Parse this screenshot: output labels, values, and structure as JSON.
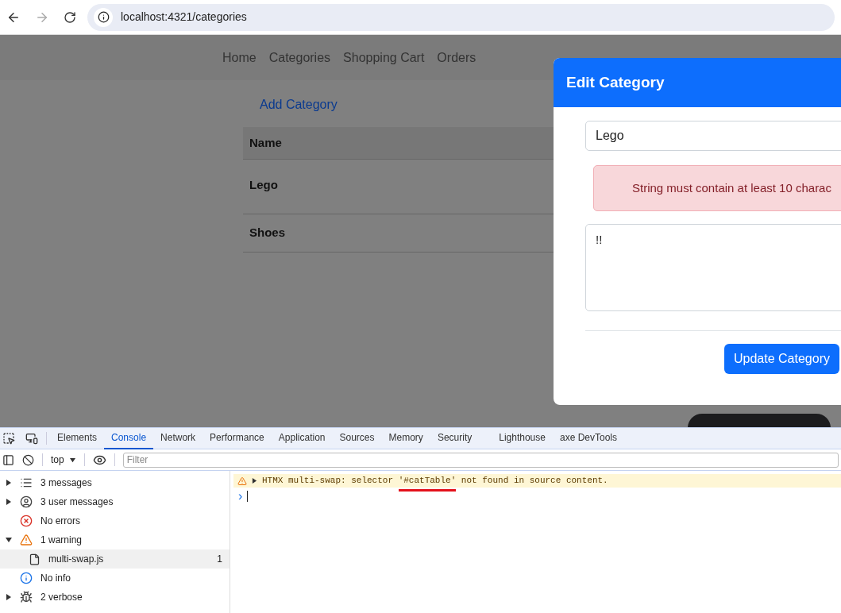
{
  "browser": {
    "back_disabled": false,
    "forward_disabled": true,
    "url": "localhost:4321/categories"
  },
  "nav": {
    "links": [
      "Home",
      "Categories",
      "Shopping Cart",
      "Orders"
    ]
  },
  "page": {
    "add_link": "Add Category",
    "table": {
      "columns": [
        "Name"
      ],
      "rows": [
        [
          "Lego"
        ],
        [
          "Shoes"
        ]
      ]
    }
  },
  "modal": {
    "title": "Edit Category",
    "name_value": "Lego",
    "alert": "String must contain at least 10 charac",
    "description_value": "!!",
    "submit": "Update Category"
  },
  "devtools": {
    "tabs": [
      {
        "label": "Elements",
        "selected": false
      },
      {
        "label": "Console",
        "selected": true
      },
      {
        "label": "Network",
        "selected": false
      },
      {
        "label": "Performance",
        "selected": false
      },
      {
        "label": "Application",
        "selected": false
      },
      {
        "label": "Sources",
        "selected": false
      },
      {
        "label": "Memory",
        "selected": false
      },
      {
        "label": "Security",
        "selected": false
      },
      {
        "label": "Lighthouse",
        "selected": false
      },
      {
        "label": "axe DevTools",
        "selected": false
      }
    ],
    "context": "top",
    "filter_placeholder": "Filter",
    "sidebar": [
      {
        "kind": "messages",
        "label": "3 messages",
        "expanded": false
      },
      {
        "kind": "user",
        "label": "3 user messages",
        "expanded": false
      },
      {
        "kind": "errors",
        "label": "No errors"
      },
      {
        "kind": "warnings",
        "label": "1 warning",
        "expanded": true,
        "children": [
          {
            "label": "multi-swap.js",
            "count": "1",
            "selected": true
          }
        ]
      },
      {
        "kind": "info",
        "label": "No info"
      },
      {
        "kind": "verbose",
        "label": "2 verbose",
        "expanded": false
      }
    ],
    "messages": [
      {
        "kind": "warning",
        "expanded": false,
        "before": "HTMX multi-swap: selector ",
        "marked": "'#catTable'",
        "after": " not found in source content."
      }
    ],
    "prompt": "›"
  }
}
